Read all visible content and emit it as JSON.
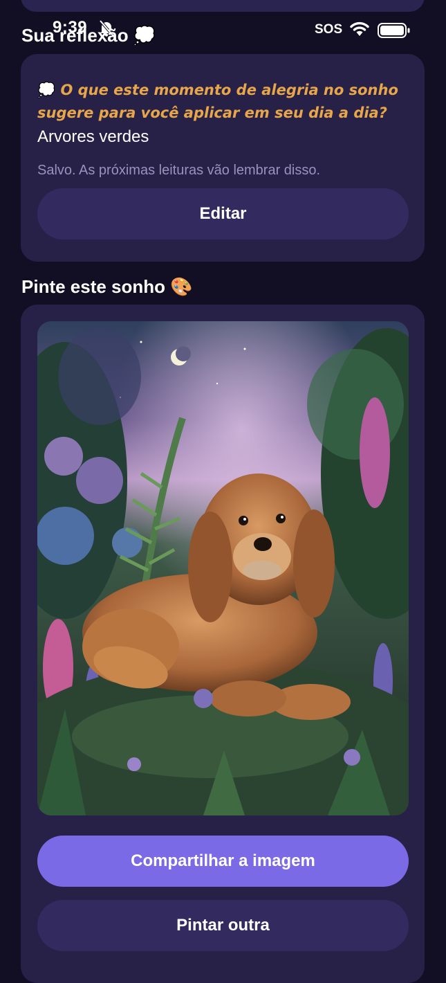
{
  "status_bar": {
    "time": "9:39",
    "carrier": "SOS"
  },
  "reflection": {
    "title": "Sua reflexão",
    "title_emoji": "💭",
    "question_emoji": "💭",
    "question": "O que este momento de alegria no sonho sugere para você aplicar em seu dia a dia?",
    "answer": "Arvores verdes",
    "saved_note": "Salvo. As próximas leituras vão lembrar disso.",
    "edit_label": "Editar"
  },
  "paint": {
    "title": "Pinte este sonho",
    "title_emoji": "🎨",
    "image_alt": "Pintura de um cachorro em um jardim noturno",
    "share_label": "Compartilhar a imagem",
    "paint_another_label": "Pintar outra"
  },
  "colors": {
    "background": "#120f24",
    "card": "#272148",
    "secondary_button": "#332b60",
    "primary_button": "#7a6ae6",
    "question_text": "#e7a64a",
    "muted_text": "#9993bd"
  },
  "icons": [
    "bell-slash-icon",
    "wifi-icon",
    "battery-icon",
    "thought-bubble-icon",
    "palette-icon"
  ]
}
